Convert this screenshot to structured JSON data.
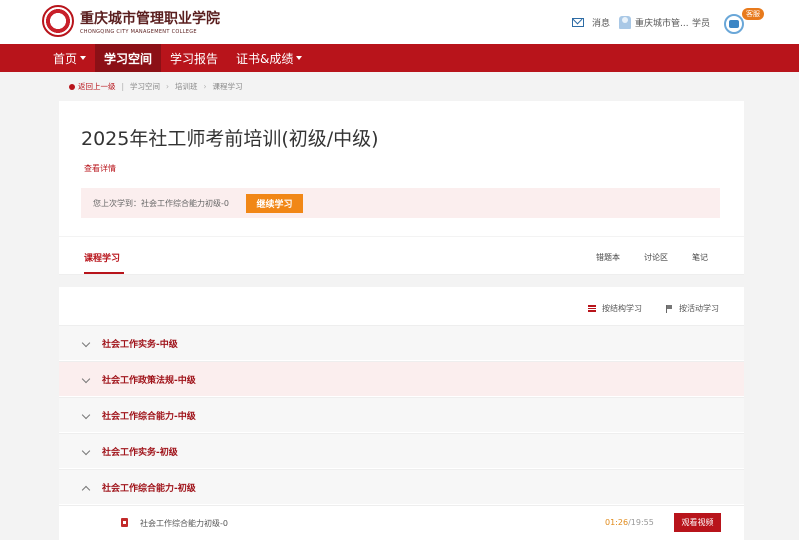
{
  "header": {
    "logo_cn": "重庆城市管理职业学院",
    "logo_en": "CHONGQING CITY MANAGEMENT COLLEGE",
    "logo_seal": "城",
    "messages_label": "消息",
    "user_name": "重庆城市管...",
    "user_role": "学员",
    "badge": "客服"
  },
  "nav": {
    "items": [
      {
        "label": "首页",
        "dropdown": true
      },
      {
        "label": "学习空间",
        "active": true
      },
      {
        "label": "学习报告"
      },
      {
        "label": "证书&成绩",
        "dropdown": true
      }
    ]
  },
  "breadcrumb": {
    "back": "返回上一级",
    "items": [
      "学习空间",
      "培训班",
      "课程学习"
    ]
  },
  "course": {
    "title": "2025年社工师考前培训(初级/中级)",
    "details_link": "查看详情",
    "resume_text": "您上次学到：社会工作综合能力初级-0",
    "continue_button": "继续学习"
  },
  "tabs": {
    "main": "课程学习",
    "right": [
      "错题本",
      "讨论区",
      "笔记"
    ]
  },
  "content": {
    "toggles": [
      "按结构学习",
      "按活动学习"
    ],
    "sections": [
      {
        "title": "社会工作实务-中级",
        "expanded": false
      },
      {
        "title": "社会工作政策法规-中级",
        "expanded": false
      },
      {
        "title": "社会工作综合能力-中级",
        "expanded": false
      },
      {
        "title": "社会工作实务-初级",
        "expanded": false
      },
      {
        "title": "社会工作综合能力-初级",
        "expanded": true
      }
    ],
    "lesson": {
      "name": "社会工作综合能力初级-0",
      "time_current": "01:26",
      "time_total": "/19:55",
      "watch_button": "观看视频"
    }
  },
  "colors": {
    "brand_red": "#b8141b",
    "accent_orange": "#f18716"
  }
}
